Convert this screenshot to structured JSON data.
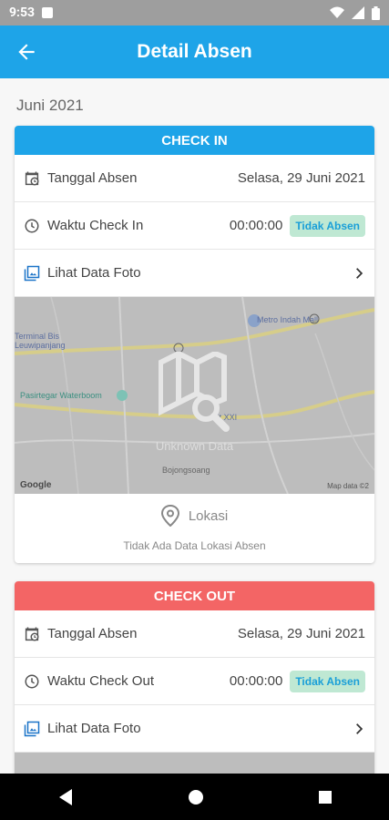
{
  "status_bar": {
    "time": "9:53"
  },
  "app_bar": {
    "title": "Detail Absen"
  },
  "month_label": "Juni 2021",
  "check_in": {
    "header": "CHECK IN",
    "date_label": "Tanggal Absen",
    "date_value": "Selasa, 29 Juni 2021",
    "time_label": "Waktu Check In",
    "time_value": "00:00:00",
    "status_badge": "Tidak Absen",
    "photo_label": "Lihat Data Foto",
    "map": {
      "unknown_label": "Unknown Data",
      "places": [
        "Metro Indah Mall",
        "Terminal Bis Leuwipanjang",
        "Pasirtegar Waterboom",
        "Transit XXI",
        "Bojongsoang"
      ],
      "attribution": "Google",
      "map_data": "Map data ©2"
    },
    "location_label": "Lokasi",
    "location_empty": "Tidak Ada Data Lokasi Absen"
  },
  "check_out": {
    "header": "CHECK OUT",
    "date_label": "Tanggal Absen",
    "date_value": "Selasa, 29 Juni 2021",
    "time_label": "Waktu Check Out",
    "time_value": "00:00:00",
    "status_badge": "Tidak Absen",
    "photo_label": "Lihat Data Foto"
  },
  "colors": {
    "primary": "#1ea4e8",
    "checkout": "#f36565",
    "badge_bg": "#bfe8d3"
  }
}
